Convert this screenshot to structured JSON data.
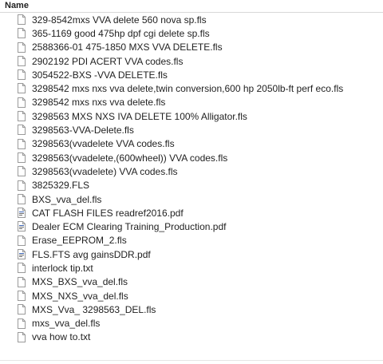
{
  "header": {
    "name_label": "Name"
  },
  "files": [
    {
      "name": "329-8542mxs VVA delete 560 nova sp.fls",
      "icon": "document-icon"
    },
    {
      "name": "365-1169 good 475hp dpf cgi delete sp.fls",
      "icon": "document-icon"
    },
    {
      "name": "2588366-01 475-1850 MXS VVA DELETE.fls",
      "icon": "document-icon"
    },
    {
      "name": "2902192 PDI ACERT VVA codes.fls",
      "icon": "document-icon"
    },
    {
      "name": "3054522-BXS -VVA DELETE.fls",
      "icon": "document-icon"
    },
    {
      "name": "3298542 mxs nxs vva delete,twin conversion,600 hp 2050lb-ft perf eco.fls",
      "icon": "document-icon"
    },
    {
      "name": "3298542 mxs nxs vva delete.fls",
      "icon": "document-icon"
    },
    {
      "name": "3298563 MXS NXS IVA DELETE 100% Alligator.fls",
      "icon": "document-icon"
    },
    {
      "name": "3298563-VVA-Delete.fls",
      "icon": "document-icon"
    },
    {
      "name": "3298563(vvadelete VVA codes.fls",
      "icon": "document-icon"
    },
    {
      "name": "3298563(vvadelete,(600wheel)) VVA codes.fls",
      "icon": "document-icon"
    },
    {
      "name": "3298563(vvadelete) VVA codes.fls",
      "icon": "document-icon"
    },
    {
      "name": "3825329.FLS",
      "icon": "document-icon"
    },
    {
      "name": "BXS_vva_del.fls",
      "icon": "document-icon"
    },
    {
      "name": "CAT FLASH FILES readref2016.pdf",
      "icon": "pdf-icon"
    },
    {
      "name": "Dealer ECM Clearing Training_Production.pdf",
      "icon": "pdf-icon"
    },
    {
      "name": "Erase_EEPROM_2.fls",
      "icon": "document-icon"
    },
    {
      "name": "FLS.FTS avg gainsDDR.pdf",
      "icon": "pdf-icon"
    },
    {
      "name": "interlock tip.txt",
      "icon": "document-icon"
    },
    {
      "name": "MXS_BXS_vva_del.fls",
      "icon": "document-icon"
    },
    {
      "name": "MXS_NXS_vva_del.fls",
      "icon": "document-icon"
    },
    {
      "name": "MXS_Vva_ 3298563_DEL.fls",
      "icon": "document-icon"
    },
    {
      "name": "mxs_vva_del.fls",
      "icon": "document-icon"
    },
    {
      "name": "vva how to.txt",
      "icon": "document-icon"
    }
  ],
  "colors": {
    "text": "#1f1f1f",
    "icon_border": "#9a9a9a",
    "pdf_accent": "#3c64b4"
  }
}
